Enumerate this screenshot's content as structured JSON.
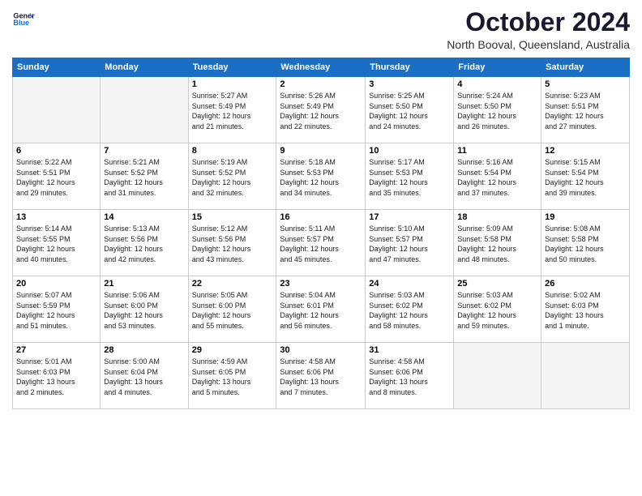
{
  "header": {
    "logo_line1": "General",
    "logo_line2": "Blue",
    "month": "October 2024",
    "location": "North Booval, Queensland, Australia"
  },
  "weekdays": [
    "Sunday",
    "Monday",
    "Tuesday",
    "Wednesday",
    "Thursday",
    "Friday",
    "Saturday"
  ],
  "weeks": [
    [
      {
        "day": "",
        "info": ""
      },
      {
        "day": "",
        "info": ""
      },
      {
        "day": "1",
        "info": "Sunrise: 5:27 AM\nSunset: 5:49 PM\nDaylight: 12 hours\nand 21 minutes."
      },
      {
        "day": "2",
        "info": "Sunrise: 5:26 AM\nSunset: 5:49 PM\nDaylight: 12 hours\nand 22 minutes."
      },
      {
        "day": "3",
        "info": "Sunrise: 5:25 AM\nSunset: 5:50 PM\nDaylight: 12 hours\nand 24 minutes."
      },
      {
        "day": "4",
        "info": "Sunrise: 5:24 AM\nSunset: 5:50 PM\nDaylight: 12 hours\nand 26 minutes."
      },
      {
        "day": "5",
        "info": "Sunrise: 5:23 AM\nSunset: 5:51 PM\nDaylight: 12 hours\nand 27 minutes."
      }
    ],
    [
      {
        "day": "6",
        "info": "Sunrise: 5:22 AM\nSunset: 5:51 PM\nDaylight: 12 hours\nand 29 minutes."
      },
      {
        "day": "7",
        "info": "Sunrise: 5:21 AM\nSunset: 5:52 PM\nDaylight: 12 hours\nand 31 minutes."
      },
      {
        "day": "8",
        "info": "Sunrise: 5:19 AM\nSunset: 5:52 PM\nDaylight: 12 hours\nand 32 minutes."
      },
      {
        "day": "9",
        "info": "Sunrise: 5:18 AM\nSunset: 5:53 PM\nDaylight: 12 hours\nand 34 minutes."
      },
      {
        "day": "10",
        "info": "Sunrise: 5:17 AM\nSunset: 5:53 PM\nDaylight: 12 hours\nand 35 minutes."
      },
      {
        "day": "11",
        "info": "Sunrise: 5:16 AM\nSunset: 5:54 PM\nDaylight: 12 hours\nand 37 minutes."
      },
      {
        "day": "12",
        "info": "Sunrise: 5:15 AM\nSunset: 5:54 PM\nDaylight: 12 hours\nand 39 minutes."
      }
    ],
    [
      {
        "day": "13",
        "info": "Sunrise: 5:14 AM\nSunset: 5:55 PM\nDaylight: 12 hours\nand 40 minutes."
      },
      {
        "day": "14",
        "info": "Sunrise: 5:13 AM\nSunset: 5:56 PM\nDaylight: 12 hours\nand 42 minutes."
      },
      {
        "day": "15",
        "info": "Sunrise: 5:12 AM\nSunset: 5:56 PM\nDaylight: 12 hours\nand 43 minutes."
      },
      {
        "day": "16",
        "info": "Sunrise: 5:11 AM\nSunset: 5:57 PM\nDaylight: 12 hours\nand 45 minutes."
      },
      {
        "day": "17",
        "info": "Sunrise: 5:10 AM\nSunset: 5:57 PM\nDaylight: 12 hours\nand 47 minutes."
      },
      {
        "day": "18",
        "info": "Sunrise: 5:09 AM\nSunset: 5:58 PM\nDaylight: 12 hours\nand 48 minutes."
      },
      {
        "day": "19",
        "info": "Sunrise: 5:08 AM\nSunset: 5:58 PM\nDaylight: 12 hours\nand 50 minutes."
      }
    ],
    [
      {
        "day": "20",
        "info": "Sunrise: 5:07 AM\nSunset: 5:59 PM\nDaylight: 12 hours\nand 51 minutes."
      },
      {
        "day": "21",
        "info": "Sunrise: 5:06 AM\nSunset: 6:00 PM\nDaylight: 12 hours\nand 53 minutes."
      },
      {
        "day": "22",
        "info": "Sunrise: 5:05 AM\nSunset: 6:00 PM\nDaylight: 12 hours\nand 55 minutes."
      },
      {
        "day": "23",
        "info": "Sunrise: 5:04 AM\nSunset: 6:01 PM\nDaylight: 12 hours\nand 56 minutes."
      },
      {
        "day": "24",
        "info": "Sunrise: 5:03 AM\nSunset: 6:02 PM\nDaylight: 12 hours\nand 58 minutes."
      },
      {
        "day": "25",
        "info": "Sunrise: 5:03 AM\nSunset: 6:02 PM\nDaylight: 12 hours\nand 59 minutes."
      },
      {
        "day": "26",
        "info": "Sunrise: 5:02 AM\nSunset: 6:03 PM\nDaylight: 13 hours\nand 1 minute."
      }
    ],
    [
      {
        "day": "27",
        "info": "Sunrise: 5:01 AM\nSunset: 6:03 PM\nDaylight: 13 hours\nand 2 minutes."
      },
      {
        "day": "28",
        "info": "Sunrise: 5:00 AM\nSunset: 6:04 PM\nDaylight: 13 hours\nand 4 minutes."
      },
      {
        "day": "29",
        "info": "Sunrise: 4:59 AM\nSunset: 6:05 PM\nDaylight: 13 hours\nand 5 minutes."
      },
      {
        "day": "30",
        "info": "Sunrise: 4:58 AM\nSunset: 6:06 PM\nDaylight: 13 hours\nand 7 minutes."
      },
      {
        "day": "31",
        "info": "Sunrise: 4:58 AM\nSunset: 6:06 PM\nDaylight: 13 hours\nand 8 minutes."
      },
      {
        "day": "",
        "info": ""
      },
      {
        "day": "",
        "info": ""
      }
    ]
  ]
}
